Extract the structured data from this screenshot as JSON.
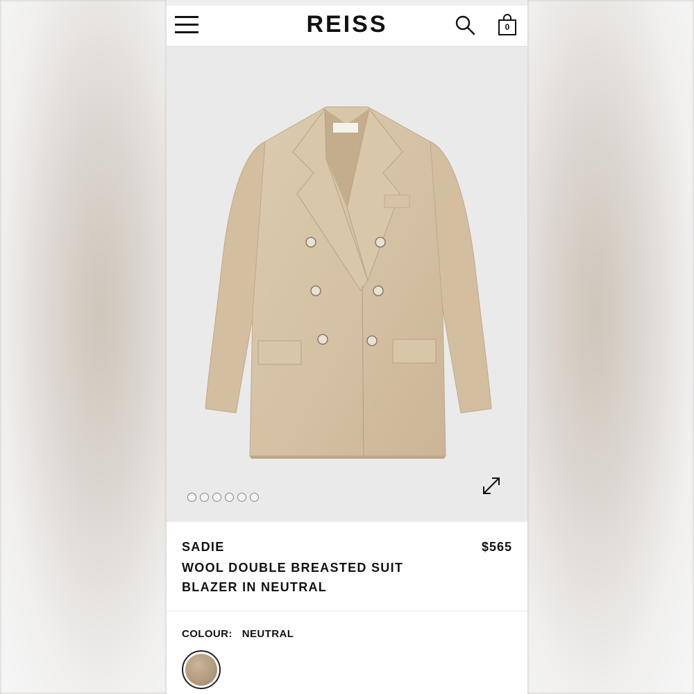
{
  "header": {
    "logo": "REISS",
    "bag_count": "0"
  },
  "gallery": {
    "image_count": 6,
    "active_index": 0
  },
  "product": {
    "brand": "SADIE",
    "name": "WOOL DOUBLE BREASTED SUIT BLAZER IN NEUTRAL",
    "price": "$565",
    "colour_label": "COLOUR:",
    "colour_value": "NEUTRAL"
  },
  "colors": {
    "accent": "#111111",
    "blazer": "#d7c4a6",
    "swatch": "#b39c80"
  },
  "icons": [
    "menu-icon",
    "search-icon",
    "bag-icon",
    "expand-icon"
  ]
}
